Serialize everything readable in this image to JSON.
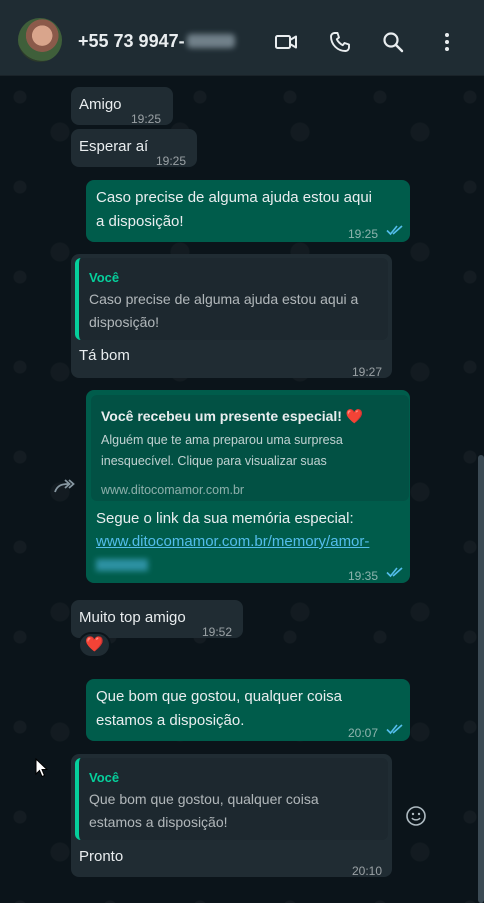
{
  "header": {
    "contact_name": "+55 73 9947-",
    "icons": [
      "video-call-icon",
      "voice-call-icon",
      "search-icon",
      "menu-icon"
    ]
  },
  "messages": [
    {
      "id": "m1",
      "dir": "in",
      "text": "Amigo",
      "time": "19:25"
    },
    {
      "id": "m2",
      "dir": "in",
      "text": "Esperar aí",
      "time": "19:25"
    },
    {
      "id": "m3",
      "dir": "out",
      "line1": "Caso precise de alguma ajuda estou aqui",
      "line2": "a disposição!",
      "time": "19:25",
      "read": true
    },
    {
      "id": "m4",
      "dir": "in",
      "quote_author": "Você",
      "quote_line1": "Caso precise de alguma ajuda estou aqui a",
      "quote_line2": "disposição!",
      "text": "Tá bom",
      "time": "19:27"
    },
    {
      "id": "m5",
      "dir": "out",
      "preview_title": "Você recebeu um presente especial! ❤️",
      "preview_line1": "Alguém que te ama preparou uma surpresa",
      "preview_line2": "inesquecível. Clique para visualizar suas",
      "preview_domain": "www.ditocomamor.com.br",
      "text": "Segue o link da sua memória especial:",
      "link_line1": "www.ditocomamor.com.br/memory/amor-",
      "time": "19:35",
      "read": true
    },
    {
      "id": "m6",
      "dir": "in",
      "text": "Muito top amigo",
      "time": "19:52"
    },
    {
      "id": "m7",
      "dir": "in",
      "reaction": "❤️"
    },
    {
      "id": "m8",
      "dir": "out",
      "line1": "Que bom que gostou, qualquer coisa",
      "line2": "estamos a disposição.",
      "time": "20:07",
      "read": true
    },
    {
      "id": "m9",
      "dir": "in",
      "quote_author": "Você",
      "quote_line1": "Que bom que gostou, qualquer coisa",
      "quote_line2": "estamos a disposição!",
      "text": "Pronto",
      "time": "20:10"
    }
  ],
  "colors": {
    "header_bg": "#1f2c33",
    "chat_bg": "#0b141a",
    "incoming_bubble": "#202c33",
    "outgoing_bubble": "#005c4b",
    "quote_accent": "#06cf9c",
    "read_ticks": "#53bdeb"
  }
}
